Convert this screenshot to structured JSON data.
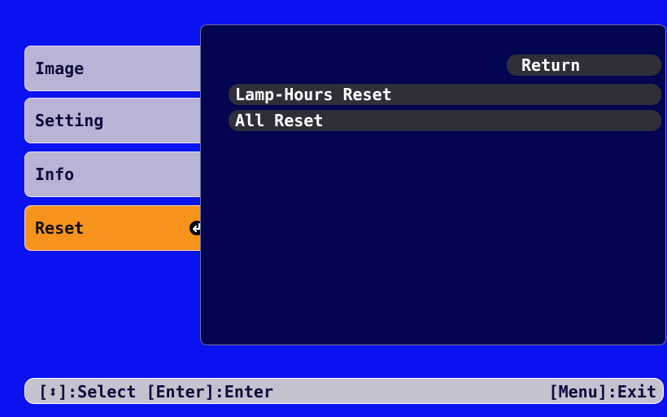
{
  "menu": {
    "items": [
      {
        "label": "Image"
      },
      {
        "label": "Setting"
      },
      {
        "label": "Info"
      },
      {
        "label": "Reset"
      }
    ],
    "active_index": 3
  },
  "panel": {
    "return_label": "Return",
    "items": [
      {
        "label": "Lamp-Hours Reset"
      },
      {
        "label": "All Reset"
      }
    ]
  },
  "statusbar": {
    "left_prefix": "[",
    "left_icon": "up-down-arrow-icon",
    "left_suffix": "]:Select [Enter]:Enter",
    "right": "[Menu]:Exit"
  },
  "colors": {
    "background": "#0a12f0",
    "panel": "#030551",
    "menu_item": "#b9b3d4",
    "menu_active": "#f6931d",
    "statusbar": "#c4c2cf"
  }
}
